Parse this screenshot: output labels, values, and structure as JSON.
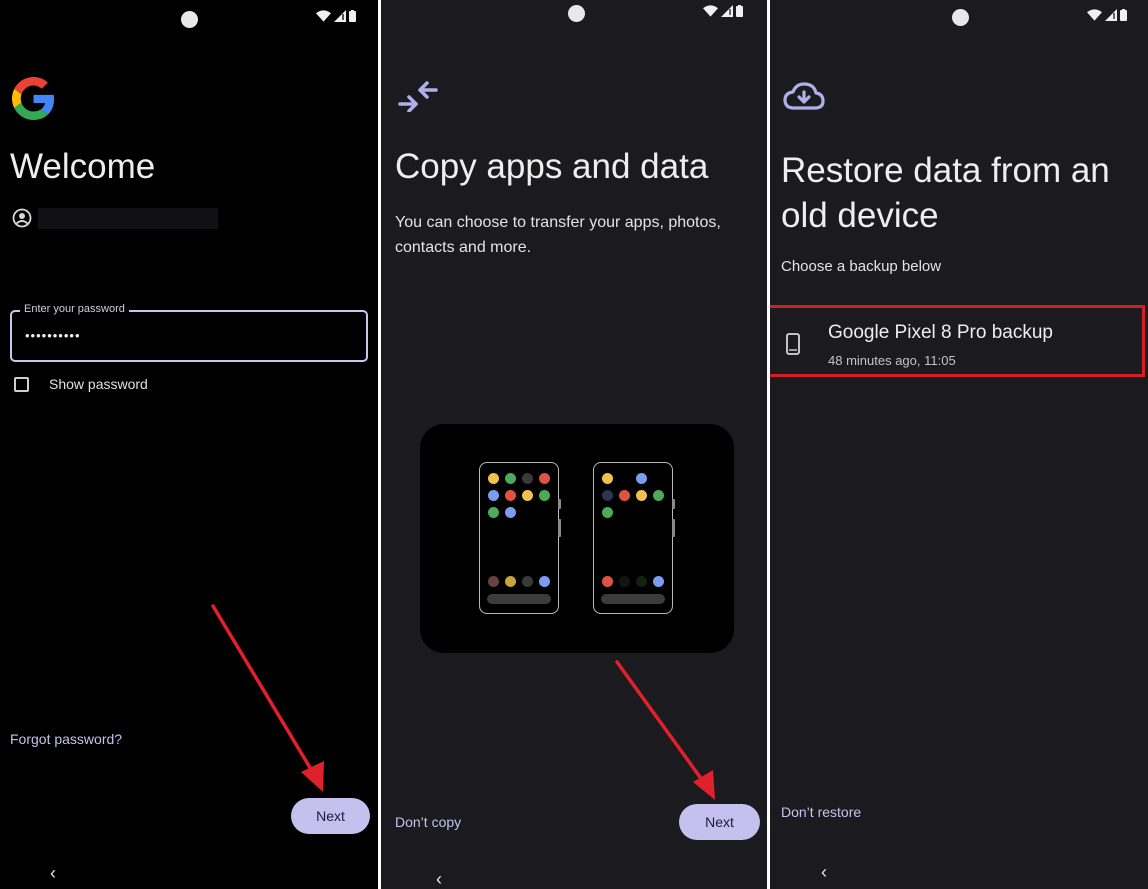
{
  "screen1": {
    "title": "Welcome",
    "password_label": "Enter your password",
    "password_value": "••••••••••",
    "show_password_label": "Show password",
    "forgot_password_label": "Forgot password?",
    "next_label": "Next",
    "back_label": "‹"
  },
  "screen2": {
    "title": "Copy apps and data",
    "description": "You can choose to transfer your apps, photos, contacts and more.",
    "dont_copy_label": "Don’t copy",
    "next_label": "Next",
    "back_label": "‹"
  },
  "screen3": {
    "title": "Restore data from an old device",
    "subtitle": "Choose a backup below",
    "backup_name": "Google Pixel 8 Pro backup",
    "backup_time": "48 minutes ago, 11:05",
    "dont_restore_label": "Don’t restore",
    "back_label": "‹"
  },
  "colors": {
    "accent": "#c5c0ee",
    "highlight_box": "#d21f26",
    "annotation_arrow": "#e0202a",
    "google_blue": "#4285F4",
    "google_red": "#EA4335",
    "google_yellow": "#FBBC05",
    "google_green": "#34A853"
  },
  "icons": {
    "screen1_logo": "google-g-icon",
    "screen1_account": "account-circle-icon",
    "screen2_header": "transfer-arrows-icon",
    "screen3_header": "cloud-download-icon",
    "screen3_backup": "phone-device-icon"
  }
}
